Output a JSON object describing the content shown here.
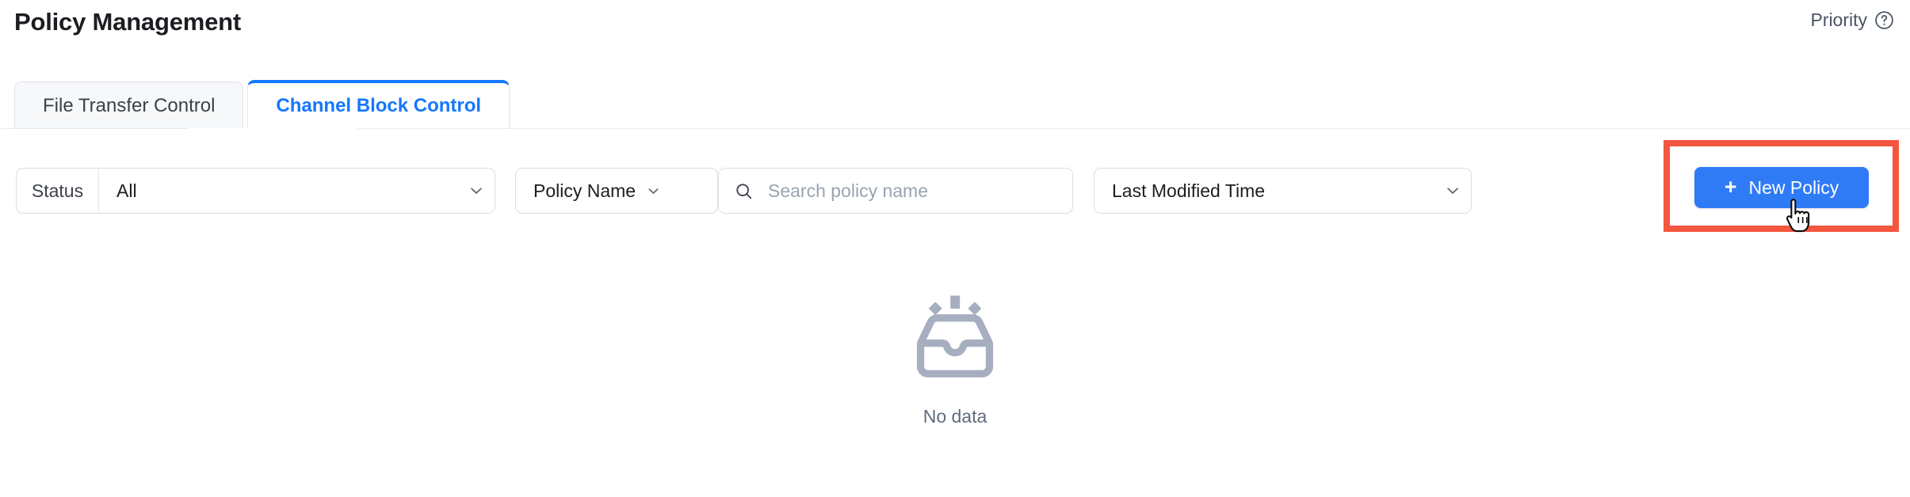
{
  "header": {
    "title": "Policy Management",
    "priority_label": "Priority",
    "help_icon": "question-circle-icon"
  },
  "tabs": [
    {
      "label": "File Transfer Control",
      "active": false
    },
    {
      "label": "Channel Block Control",
      "active": true
    }
  ],
  "filters": {
    "status": {
      "prefix_label": "Status",
      "value": "All",
      "chevron_icon": "chevron-down-icon"
    },
    "policy_name": {
      "label": "Policy Name",
      "chevron_icon": "chevron-down-icon"
    },
    "search": {
      "icon": "search-icon",
      "value": "",
      "placeholder": "Search policy name"
    },
    "last_modified": {
      "label": "Last Modified Time",
      "chevron_icon": "chevron-down-icon"
    }
  },
  "actions": {
    "new_policy": {
      "label": "New Policy",
      "plus_icon": "plus-icon",
      "color": "#2f7bf6"
    },
    "highlight_color": "#f4563f",
    "cursor_icon": "hand-pointer-cursor"
  },
  "empty_state": {
    "icon": "empty-inbox-icon",
    "text": "No data",
    "icon_color": "#a6aec0"
  }
}
